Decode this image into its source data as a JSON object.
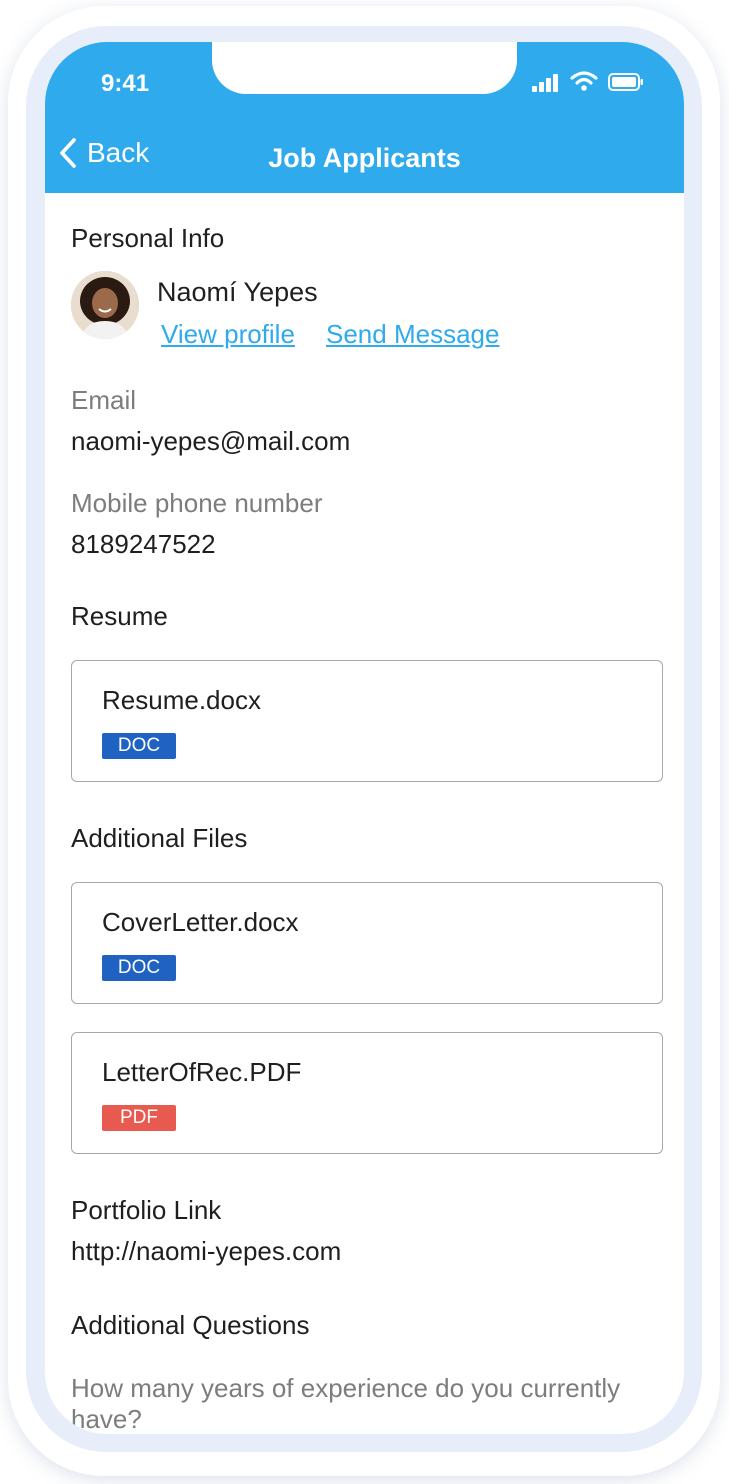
{
  "status_bar": {
    "time": "9:41"
  },
  "header": {
    "back_label": "Back",
    "title": "Job Applicants"
  },
  "personal_info": {
    "section_title": "Personal Info",
    "name": "Naomí Yepes",
    "view_profile": "View profile",
    "send_message": "Send Message"
  },
  "email": {
    "label": "Email",
    "value": "naomi-yepes@mail.com"
  },
  "phone": {
    "label": "Mobile phone number",
    "value": "8189247522"
  },
  "resume": {
    "section_title": "Resume",
    "files": [
      {
        "name": "Resume.docx",
        "type": "DOC",
        "color": "#1f62c2"
      }
    ]
  },
  "additional_files": {
    "section_title": "Additional Files",
    "files": [
      {
        "name": "CoverLetter.docx",
        "type": "DOC",
        "color": "#1f62c2"
      },
      {
        "name": "LetterOfRec.PDF",
        "type": "PDF",
        "color": "#e85a4f"
      }
    ]
  },
  "portfolio": {
    "label": "Portfolio Link",
    "value": "http://naomi-yepes.com"
  },
  "additional_questions": {
    "section_title": "Additional Questions",
    "question_1": "How many years of experience do you currently have?"
  },
  "colors": {
    "accent": "#2eaaed",
    "doc_badge": "#1f62c2",
    "pdf_badge": "#e85a4f"
  }
}
